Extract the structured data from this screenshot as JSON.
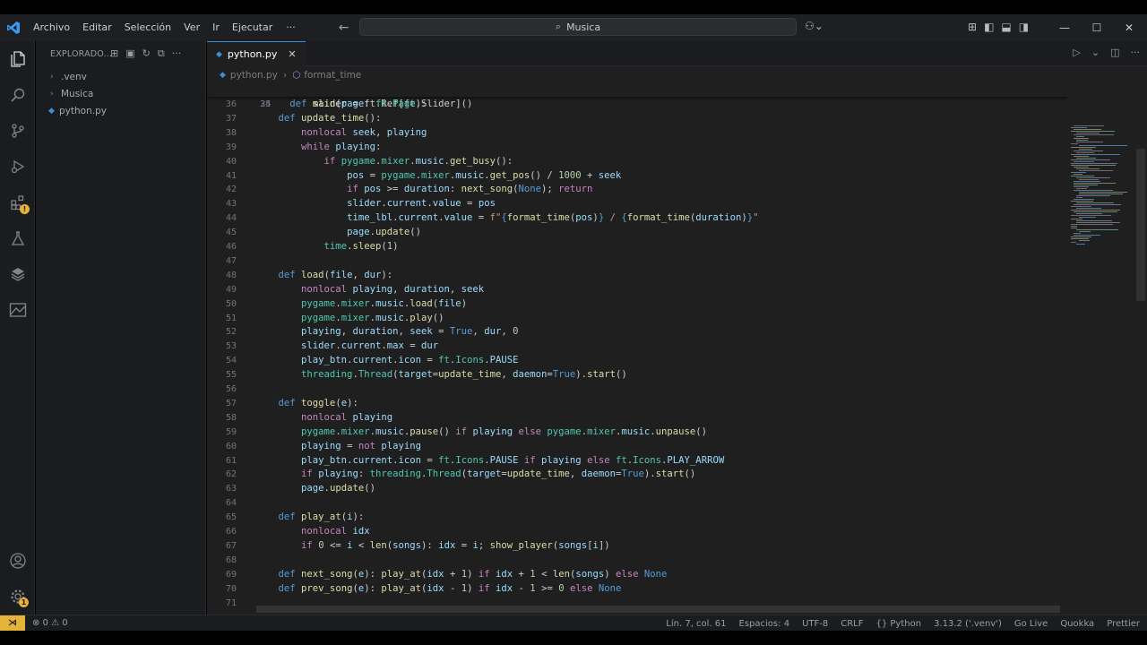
{
  "menu": [
    "Archivo",
    "Editar",
    "Selección",
    "Ver",
    "Ir",
    "Ejecutar",
    "···"
  ],
  "search": {
    "text": "Musica"
  },
  "sidebar": {
    "title": "EXPLORADO...",
    "items": [
      {
        "label": ".venv",
        "kind": "folder"
      },
      {
        "label": "Musica",
        "kind": "folder"
      },
      {
        "label": "python.py",
        "kind": "file"
      }
    ]
  },
  "tab": {
    "label": "python.py"
  },
  "breadcrumb": {
    "file": "python.py",
    "symbol": "format_time"
  },
  "code": {
    "sticky": {
      "num": "24",
      "html": "<span class='def'>def</span> <span class='fn'>main</span>(<span class='param'>page</span>: <span class='mod'>ft</span>.<span class='mod'>Page</span>):"
    },
    "partial": {
      "num": "35",
      "text": "    slider = ft.Ref[ft.Slider]()"
    },
    "lines": [
      {
        "num": "36",
        "html": ""
      },
      {
        "num": "37",
        "html": "    <span class='def'>def</span> <span class='fn'>update_time</span>():"
      },
      {
        "num": "38",
        "html": "        <span class='kw'>nonlocal</span> <span class='param'>seek</span>, <span class='param'>playing</span>"
      },
      {
        "num": "39",
        "html": "        <span class='kw'>while</span> <span class='param'>playing</span>:"
      },
      {
        "num": "40",
        "html": "            <span class='kw'>if</span> <span class='mod'>pygame</span>.<span class='mod'>mixer</span>.<span class='param'>music</span>.<span class='fn'>get_busy</span>():"
      },
      {
        "num": "41",
        "html": "                <span class='param'>pos</span> = <span class='mod'>pygame</span>.<span class='mod'>mixer</span>.<span class='param'>music</span>.<span class='fn'>get_pos</span>() / <span class='num'>1000</span> + <span class='param'>seek</span>"
      },
      {
        "num": "42",
        "html": "                <span class='kw'>if</span> <span class='param'>pos</span> >= <span class='param'>duration</span>: <span class='fn'>next_song</span>(<span class='bl'>None</span>); <span class='kw'>return</span>"
      },
      {
        "num": "43",
        "html": "                <span class='param'>slider</span>.<span class='param'>current</span>.<span class='param'>value</span> = <span class='param'>pos</span>"
      },
      {
        "num": "44",
        "html": "                <span class='param'>time_lbl</span>.<span class='param'>current</span>.<span class='param'>value</span> = <span class='str'>f\"</span><span class='bl'>{</span><span class='fn'>format_time</span>(<span class='param'>pos</span>)<span class='bl'>}</span><span class='str'> / </span><span class='bl'>{</span><span class='fn'>format_time</span>(<span class='param'>duration</span>)<span class='bl'>}</span><span class='str'>\"</span>"
      },
      {
        "num": "45",
        "html": "                <span class='param'>page</span>.<span class='fn'>update</span>()"
      },
      {
        "num": "46",
        "html": "            <span class='mod'>time</span>.<span class='fn'>sleep</span>(<span class='num'>1</span>)"
      },
      {
        "num": "47",
        "html": ""
      },
      {
        "num": "48",
        "html": "    <span class='def'>def</span> <span class='fn'>load</span>(<span class='param'>file</span>, <span class='param'>dur</span>):"
      },
      {
        "num": "49",
        "html": "        <span class='kw'>nonlocal</span> <span class='param'>playing</span>, <span class='param'>duration</span>, <span class='param'>seek</span>"
      },
      {
        "num": "50",
        "html": "        <span class='mod'>pygame</span>.<span class='mod'>mixer</span>.<span class='param'>music</span>.<span class='fn'>load</span>(<span class='param'>file</span>)"
      },
      {
        "num": "51",
        "html": "        <span class='mod'>pygame</span>.<span class='mod'>mixer</span>.<span class='param'>music</span>.<span class='fn'>play</span>()"
      },
      {
        "num": "52",
        "html": "        <span class='param'>playing</span>, <span class='param'>duration</span>, <span class='param'>seek</span> = <span class='bl'>True</span>, <span class='param'>dur</span>, <span class='num'>0</span>"
      },
      {
        "num": "53",
        "html": "        <span class='param'>slider</span>.<span class='param'>current</span>.<span class='param'>max</span> = <span class='param'>dur</span>"
      },
      {
        "num": "54",
        "html": "        <span class='param'>play_btn</span>.<span class='param'>current</span>.<span class='param'>icon</span> = <span class='mod'>ft</span>.<span class='mod'>Icons</span>.<span class='param'>PAUSE</span>"
      },
      {
        "num": "55",
        "html": "        <span class='mod'>threading</span>.<span class='mod'>Thread</span>(<span class='param'>target</span>=<span class='fn'>update_time</span>, <span class='param'>daemon</span>=<span class='bl'>True</span>).<span class='fn'>start</span>()"
      },
      {
        "num": "56",
        "html": ""
      },
      {
        "num": "57",
        "html": "    <span class='def'>def</span> <span class='fn'>toggle</span>(<span class='param'>e</span>):"
      },
      {
        "num": "58",
        "html": "        <span class='kw'>nonlocal</span> <span class='param'>playing</span>"
      },
      {
        "num": "59",
        "html": "        <span class='mod'>pygame</span>.<span class='mod'>mixer</span>.<span class='param'>music</span>.<span class='fn'>pause</span>() <span class='kw'>if</span> <span class='param'>playing</span> <span class='kw'>else</span> <span class='mod'>pygame</span>.<span class='mod'>mixer</span>.<span class='param'>music</span>.<span class='fn'>unpause</span>()"
      },
      {
        "num": "60",
        "html": "        <span class='param'>playing</span> = <span class='kw'>not</span> <span class='param'>playing</span>"
      },
      {
        "num": "61",
        "html": "        <span class='param'>play_btn</span>.<span class='param'>current</span>.<span class='param'>icon</span> = <span class='mod'>ft</span>.<span class='mod'>Icons</span>.<span class='param'>PAUSE</span> <span class='kw'>if</span> <span class='param'>playing</span> <span class='kw'>else</span> <span class='mod'>ft</span>.<span class='mod'>Icons</span>.<span class='param'>PLAY_ARROW</span>"
      },
      {
        "num": "62",
        "html": "        <span class='kw'>if</span> <span class='param'>playing</span>: <span class='mod'>threading</span>.<span class='mod'>Thread</span>(<span class='param'>target</span>=<span class='fn'>update_time</span>, <span class='param'>daemon</span>=<span class='bl'>True</span>).<span class='fn'>start</span>()"
      },
      {
        "num": "63",
        "html": "        <span class='param'>page</span>.<span class='fn'>update</span>()"
      },
      {
        "num": "64",
        "html": ""
      },
      {
        "num": "65",
        "html": "    <span class='def'>def</span> <span class='fn'>play_at</span>(<span class='param'>i</span>):"
      },
      {
        "num": "66",
        "html": "        <span class='kw'>nonlocal</span> <span class='param'>idx</span>"
      },
      {
        "num": "67",
        "html": "        <span class='kw'>if</span> <span class='num'>0</span> <= <span class='param'>i</span> < <span class='fn'>len</span>(<span class='param'>songs</span>): <span class='param'>idx</span> = <span class='param'>i</span>; <span class='fn'>show_player</span>(<span class='param'>songs</span>[<span class='param'>i</span>])"
      },
      {
        "num": "68",
        "html": ""
      },
      {
        "num": "69",
        "html": "    <span class='def'>def</span> <span class='fn'>next_song</span>(<span class='param'>e</span>): <span class='fn'>play_at</span>(<span class='param'>idx</span> + <span class='num'>1</span>) <span class='kw'>if</span> <span class='param'>idx</span> + <span class='num'>1</span> < <span class='fn'>len</span>(<span class='param'>songs</span>) <span class='kw'>else</span> <span class='bl'>None</span>"
      },
      {
        "num": "70",
        "html": "    <span class='def'>def</span> <span class='fn'>prev_song</span>(<span class='param'>e</span>): <span class='fn'>play_at</span>(<span class='param'>idx</span> - <span class='num'>1</span>) <span class='kw'>if</span> <span class='param'>idx</span> - <span class='num'>1</span> >= <span class='num'>0</span> <span class='kw'>else</span> <span class='bl'>None</span>"
      },
      {
        "num": "71",
        "html": ""
      }
    ]
  },
  "status": {
    "problems": "⊗ 0 ⚠ 0",
    "position": "Lín. 7, col. 61",
    "spaces": "Espacios: 4",
    "encoding": "UTF-8",
    "eol": "CRLF",
    "language": "{} Python",
    "interpreter": "3.13.2 ('.venv')",
    "golive": "Go Live",
    "quokka": "Quokka",
    "prettier": "Prettier"
  },
  "colors": {
    "accent": "#3c8dd7",
    "remote": "#e5b33a",
    "background": "#1f1f1f"
  }
}
